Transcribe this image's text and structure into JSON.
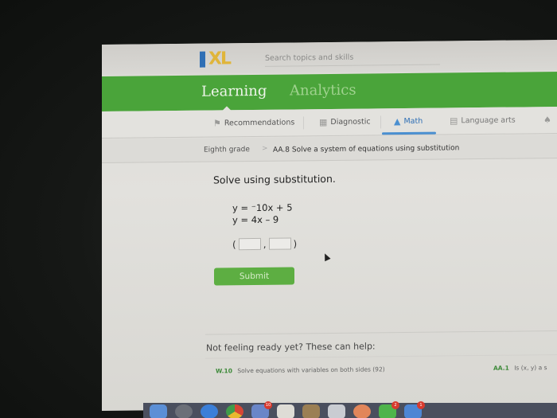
{
  "header": {
    "logo": "IXL",
    "search_placeholder": "Search topics and skills"
  },
  "main_tabs": [
    {
      "label": "Learning",
      "active": true
    },
    {
      "label": "Analytics",
      "active": false
    }
  ],
  "subnav": [
    {
      "label": "Recommendations",
      "icon": "recommendations-icon",
      "active": false
    },
    {
      "label": "Diagnostic",
      "icon": "diagnostic-icon",
      "active": false
    },
    {
      "label": "Math",
      "icon": "math-pyramid-icon",
      "active": true
    },
    {
      "label": "Language arts",
      "icon": "book-icon",
      "active": false
    }
  ],
  "breadcrumb": {
    "grade": "Eighth grade",
    "separator": ">",
    "skill": "AA.8 Solve a system of equations using substitution"
  },
  "problem": {
    "instruction": "Solve using substitution.",
    "equations": [
      "y = ⁻10x + 5",
      "y = 4x – 9"
    ],
    "answer": {
      "open": "(",
      "comma": ",",
      "close": ")",
      "x_value": "",
      "y_value": ""
    },
    "submit_label": "Submit"
  },
  "help": {
    "title": "Not feeling ready yet? These can help:",
    "items": [
      {
        "code": "W.10",
        "label": "Solve equations with variables on both sides (92)"
      },
      {
        "code": "AA.1",
        "label": "Is (x, y) a s"
      }
    ]
  },
  "dock": {
    "icons": [
      "finder-icon",
      "launchpad-icon",
      "safari-icon",
      "chrome-icon",
      "photos-icon",
      "notes-icon",
      "folder-icon",
      "preview-icon",
      "app-icon",
      "messages-icon",
      "mail-icon"
    ],
    "badges": {
      "photos-icon": "10",
      "messages-icon": "2",
      "mail-icon": "1"
    }
  }
}
